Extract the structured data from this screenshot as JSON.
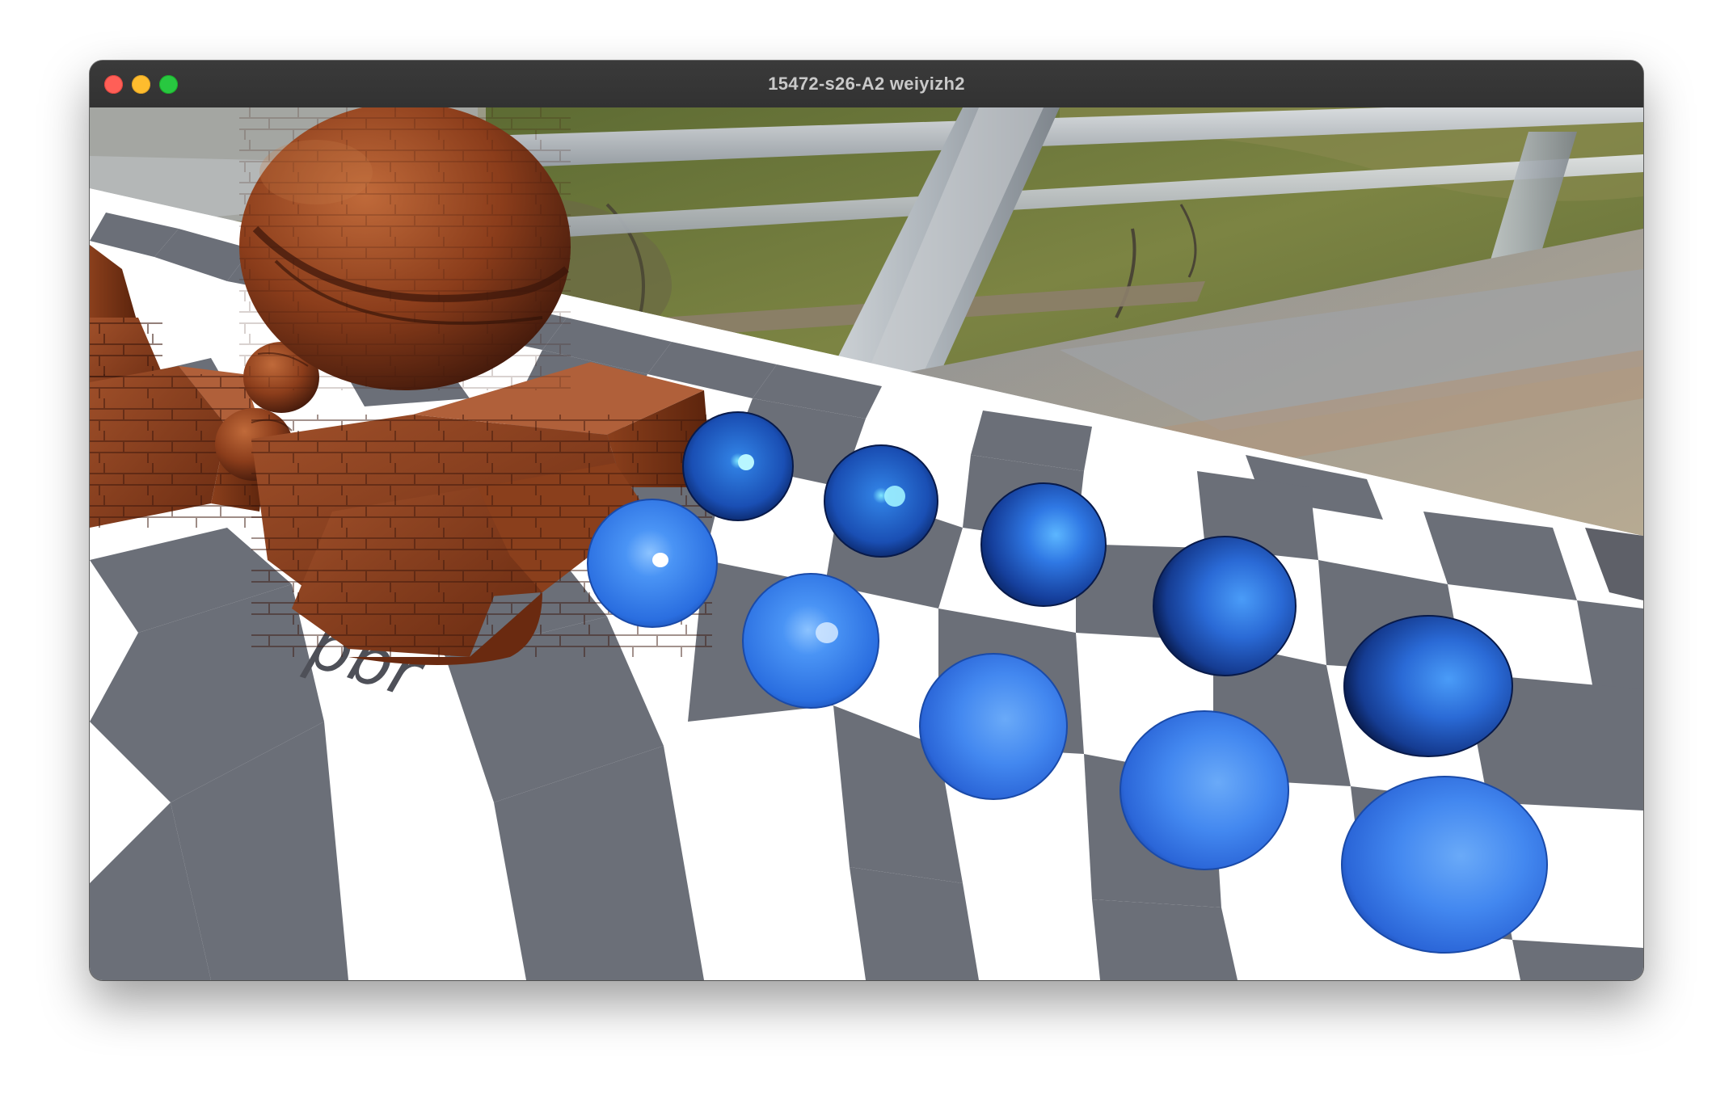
{
  "window": {
    "title": "15472-s26-A2 weiyizh2"
  },
  "scene": {
    "floor_label": "pbr",
    "colors": {
      "checker_light": "#ffffff",
      "checker_dark": "#6b6f78",
      "sphere_blue": "#3a86f0",
      "sphere_dark": "#0f2f7c",
      "wood": "#8a4020",
      "wood_dark": "#4a1c0a",
      "foliage": "#6f7a3c",
      "bridge_steel": "#b6bcc2"
    }
  }
}
